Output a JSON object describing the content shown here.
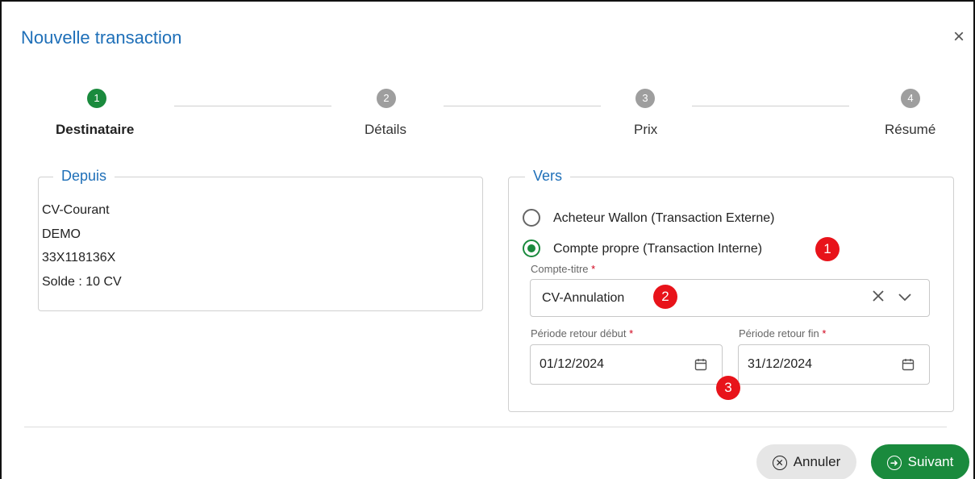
{
  "dialog": {
    "title": "Nouvelle transaction",
    "close_icon": "×"
  },
  "stepper": {
    "steps": [
      {
        "number": "1",
        "label": "Destinataire",
        "state": "active"
      },
      {
        "number": "2",
        "label": "Détails",
        "state": "inactive"
      },
      {
        "number": "3",
        "label": "Prix",
        "state": "inactive"
      },
      {
        "number": "4",
        "label": "Résumé",
        "state": "inactive"
      }
    ]
  },
  "from": {
    "legend": "Depuis",
    "lines": [
      "CV-Courant",
      "DEMO",
      "33X118136X",
      "Solde : 10 CV"
    ]
  },
  "to": {
    "legend": "Vers",
    "options": [
      {
        "label": "Acheteur Wallon (Transaction Externe)",
        "checked": false
      },
      {
        "label": "Compte propre (Transaction Interne)",
        "checked": true
      }
    ],
    "account_label": "Compte-titre",
    "account_value": "CV-Annulation",
    "start_label": "Période retour début",
    "start_value": "01/12/2024",
    "end_label": "Période retour fin",
    "end_value": "31/12/2024",
    "required_mark": "*"
  },
  "annotations": [
    "1",
    "2",
    "3"
  ],
  "footer": {
    "cancel_label": "Annuler",
    "next_label": "Suivant"
  },
  "colors": {
    "accent": "#1e6fb8",
    "success": "#1a8a3d",
    "annotation": "#e8131a"
  }
}
